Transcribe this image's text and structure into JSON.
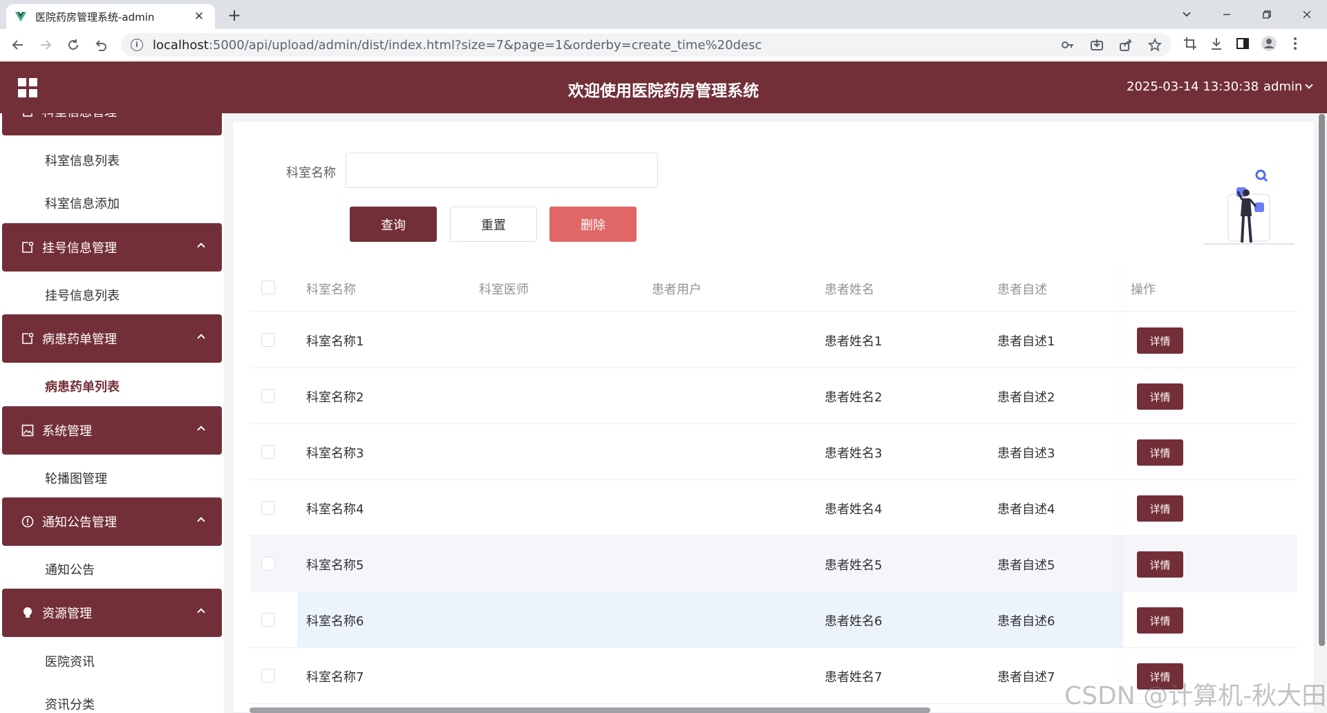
{
  "browser": {
    "tab_title": "医院药房管理系统-admin",
    "url_host": "localhost",
    "url_path": ":5000/api/upload/admin/dist/index.html?size=7&page=1&orderby=create_time%20desc"
  },
  "header": {
    "title": "欢迎使用医院药房管理系统",
    "datetime": "2025-03-14 13:30:38",
    "user": "admin"
  },
  "sidebar": {
    "group0": "科室信息管理",
    "group0_items": [
      "科室信息列表",
      "科室信息添加"
    ],
    "group1": "挂号信息管理",
    "group1_items": [
      "挂号信息列表"
    ],
    "group2": "病患药单管理",
    "group2_items": [
      "病患药单列表"
    ],
    "group3": "系统管理",
    "group3_items": [
      "轮播图管理"
    ],
    "group4": "通知公告管理",
    "group4_items": [
      "通知公告"
    ],
    "group5": "资源管理",
    "group5_items": [
      "医院资讯",
      "资讯分类"
    ]
  },
  "search": {
    "label": "科室名称",
    "value": "",
    "query_label": "查询",
    "reset_label": "重置",
    "delete_label": "删除"
  },
  "table": {
    "columns": [
      "科室名称",
      "科室医师",
      "患者用户",
      "患者姓名",
      "患者自述",
      "操作"
    ],
    "detail_label": "详情",
    "rows": [
      {
        "dept": "科室名称1",
        "doctor": "",
        "user": "",
        "name": "患者姓名1",
        "desc": "患者自述1"
      },
      {
        "dept": "科室名称2",
        "doctor": "",
        "user": "",
        "name": "患者姓名2",
        "desc": "患者自述2"
      },
      {
        "dept": "科室名称3",
        "doctor": "",
        "user": "",
        "name": "患者姓名3",
        "desc": "患者自述3"
      },
      {
        "dept": "科室名称4",
        "doctor": "",
        "user": "",
        "name": "患者姓名4",
        "desc": "患者自述4"
      },
      {
        "dept": "科室名称5",
        "doctor": "",
        "user": "",
        "name": "患者姓名5",
        "desc": "患者自述5"
      },
      {
        "dept": "科室名称6",
        "doctor": "",
        "user": "",
        "name": "患者姓名6",
        "desc": "患者自述6"
      },
      {
        "dept": "科室名称7",
        "doctor": "",
        "user": "",
        "name": "患者姓名7",
        "desc": "患者自述7"
      }
    ]
  },
  "watermark": "CSDN @计算机-秋大田",
  "colors": {
    "brand": "#732f38",
    "danger": "#e06765"
  }
}
